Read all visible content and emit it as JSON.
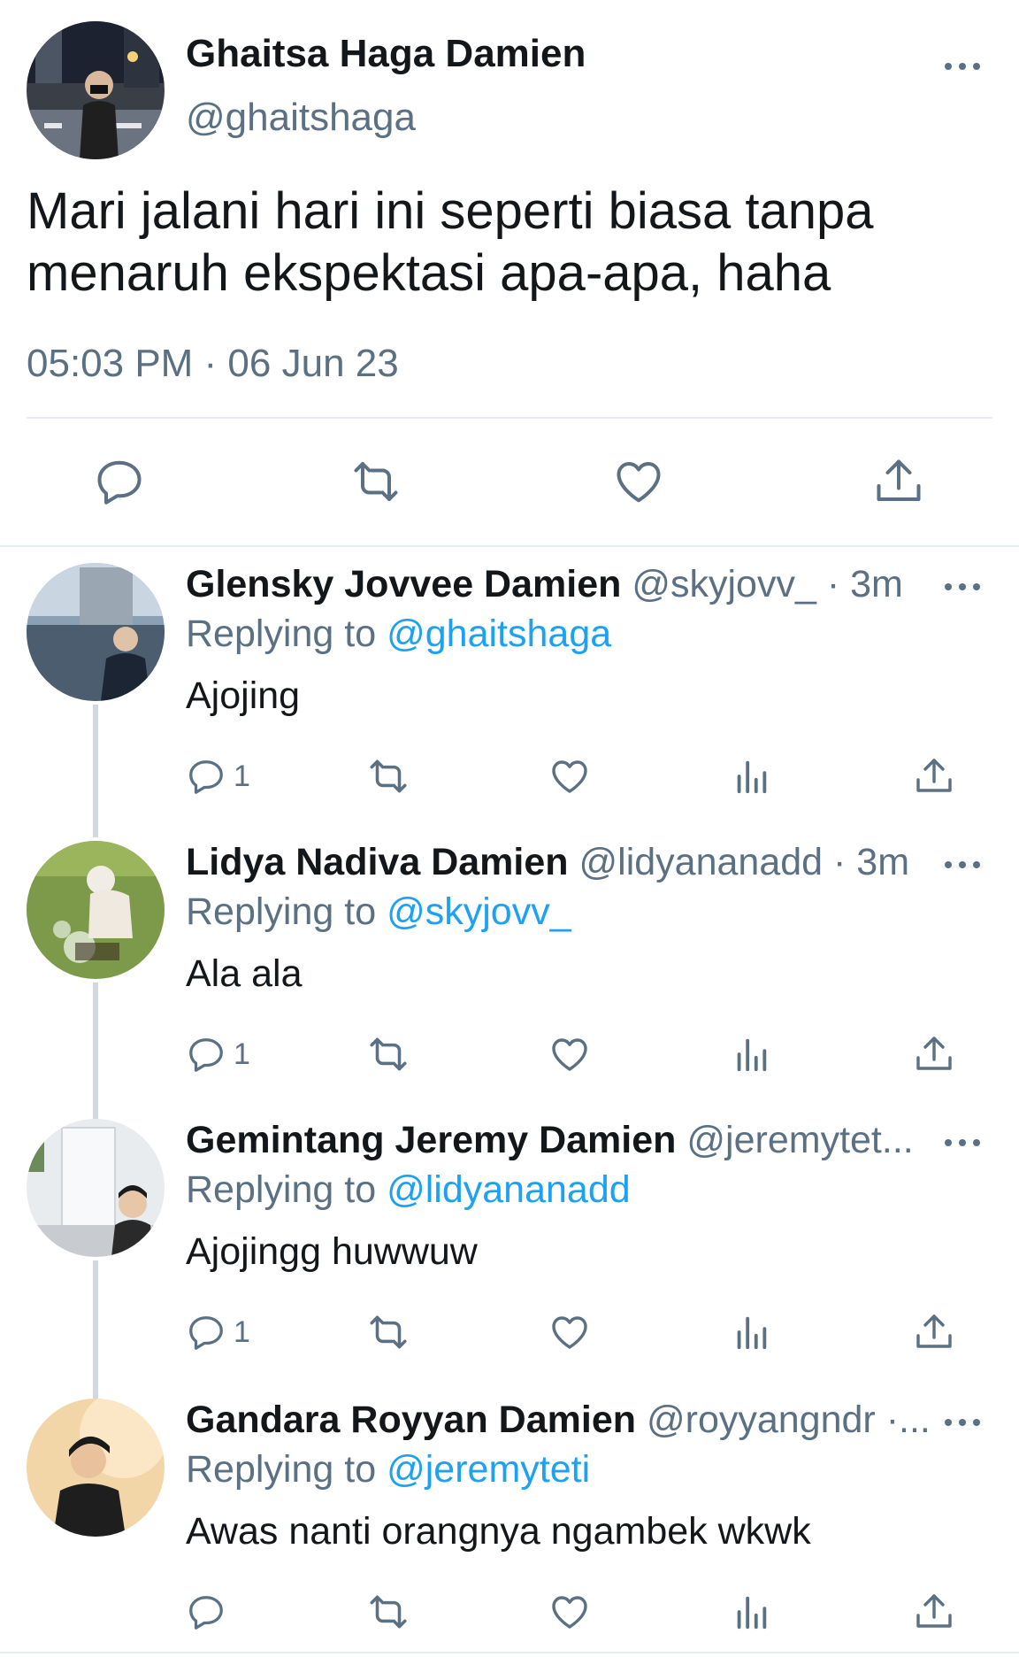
{
  "main_tweet": {
    "name": "Ghaitsa Haga Damien",
    "handle": "@ghaitshaga",
    "text": "Mari jalani hari ini seperti biasa tanpa menaruh ekspektasi apa-apa, haha",
    "timestamp": "05:03 PM · 06 Jun 23",
    "actions": [
      "reply-icon",
      "retweet-icon",
      "like-icon",
      "share-icon"
    ]
  },
  "replies": [
    {
      "name": "Glensky Jovvee Damien",
      "meta": "@skyjovv_ · 3m",
      "replying_prefix": "Replying to",
      "replying_to": "@ghaitshaga",
      "text": "Ajojing",
      "reply_count": "1"
    },
    {
      "name": "Lidya Nadiva Damien",
      "meta": "@lidyananadd · 3m",
      "replying_prefix": "Replying to",
      "replying_to": "@skyjovv_",
      "text": "Ala ala",
      "reply_count": "1"
    },
    {
      "name": "Gemintang Jeremy Damien",
      "meta": "@jeremytet...",
      "replying_prefix": "Replying to",
      "replying_to": "@lidyananadd",
      "text": "Ajojingg huwwuw",
      "reply_count": "1"
    },
    {
      "name": "Gandara Royyan Damien",
      "meta": "@royyangndr ·...",
      "replying_prefix": "Replying to",
      "replying_to": "@jeremyteti",
      "text": "Awas nanti orangnya ngambek wkwk",
      "reply_count": ""
    }
  ],
  "colors": {
    "text": "#14171a",
    "secondary": "#5b7083",
    "accent": "#1da1f2",
    "divider": "#e6ecf0",
    "thread_line": "#cfd9de"
  }
}
